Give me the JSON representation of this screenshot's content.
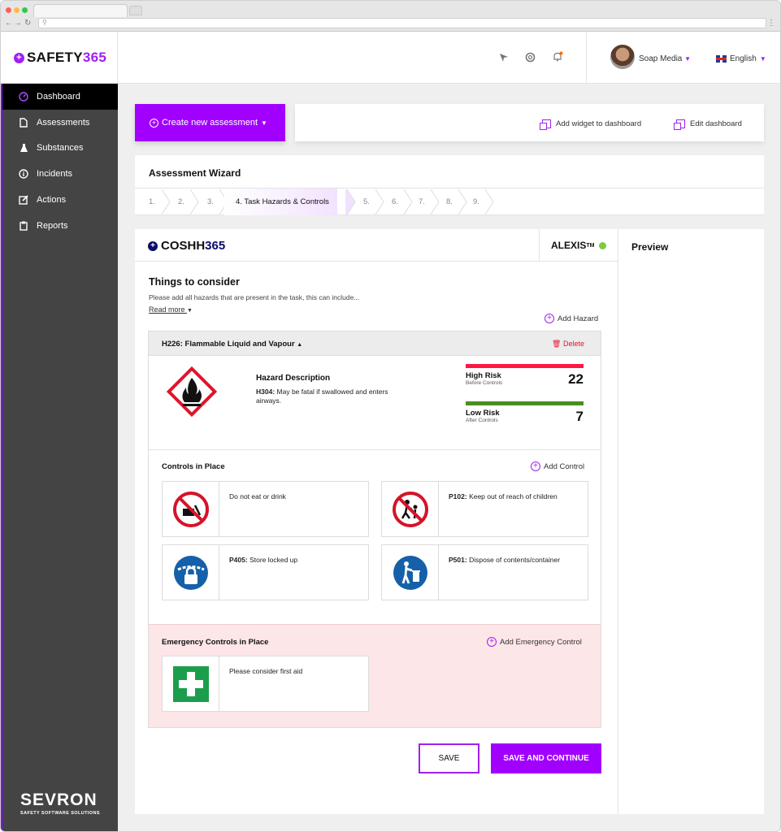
{
  "app": {
    "logo_prefix": "SAFETY",
    "logo_suffix": "365"
  },
  "header": {
    "user_name": "Soap Media",
    "language": "English"
  },
  "sidebar": {
    "items": [
      {
        "label": "Dashboard",
        "icon": "dashboard-icon"
      },
      {
        "label": "Assessments",
        "icon": "document-icon"
      },
      {
        "label": "Substances",
        "icon": "flask-icon"
      },
      {
        "label": "Incidents",
        "icon": "info-icon"
      },
      {
        "label": "Actions",
        "icon": "edit-icon"
      },
      {
        "label": "Reports",
        "icon": "clipboard-icon"
      }
    ],
    "brand": "SEVRON",
    "brand_tagline": "SAFETY SOFTWARE SOLUTIONS"
  },
  "toolbar": {
    "create_label": "Create new assessment",
    "add_widget_label": "Add widget to dashboard",
    "edit_dashboard_label": "Edit dashboard"
  },
  "wizard": {
    "title": "Assessment Wizard",
    "steps": [
      "1.",
      "2.",
      "3.",
      "4. Task Hazards & Controls",
      "5.",
      "6.",
      "7.",
      "8.",
      "9."
    ]
  },
  "coshh": {
    "logo_prefix": "COSHH",
    "logo_suffix": "365",
    "assistant": "ALEXIS",
    "assistant_mark": "TM"
  },
  "consider": {
    "title": "Things to consider",
    "desc": "Please add all hazards that are present in the task, this can include...",
    "read_more": "Read more",
    "add_hazard": "Add Hazard"
  },
  "hazard": {
    "title": "H226: Flammable Liquid and Vapour",
    "delete_label": "Delete",
    "desc_title": "Hazard Description",
    "desc_code": "H304:",
    "desc_text": "May be fatal if swallowed and enters airways.",
    "high_risk": {
      "label": "High Risk",
      "sub": "Before Controls",
      "value": "22",
      "color": "#ff1744"
    },
    "low_risk": {
      "label": "Low Risk",
      "sub": "After Controls",
      "value": "7",
      "color": "#4a8f1e"
    }
  },
  "controls": {
    "title": "Controls in Place",
    "add_label": "Add Control",
    "items": [
      {
        "code": "",
        "text": "Do not eat or drink",
        "icon": "no-eating-icon"
      },
      {
        "code": "P102:",
        "text": "Keep out of reach of children",
        "icon": "no-children-icon"
      },
      {
        "code": "P405:",
        "text": "Store locked up",
        "icon": "padlock-icon"
      },
      {
        "code": "P501:",
        "text": "Dispose of contents/container",
        "icon": "dispose-icon"
      }
    ]
  },
  "emergency": {
    "title": "Emergency Controls in Place",
    "add_label": "Add Emergency Control",
    "items": [
      {
        "text": "Please consider first aid",
        "icon": "first-aid-icon"
      }
    ]
  },
  "actions": {
    "save": "SAVE",
    "save_continue": "SAVE AND CONTINUE"
  },
  "preview": {
    "title": "Preview"
  },
  "colors": {
    "accent": "#a100ff",
    "sidebar": "#444444",
    "danger": "#e0142e"
  }
}
